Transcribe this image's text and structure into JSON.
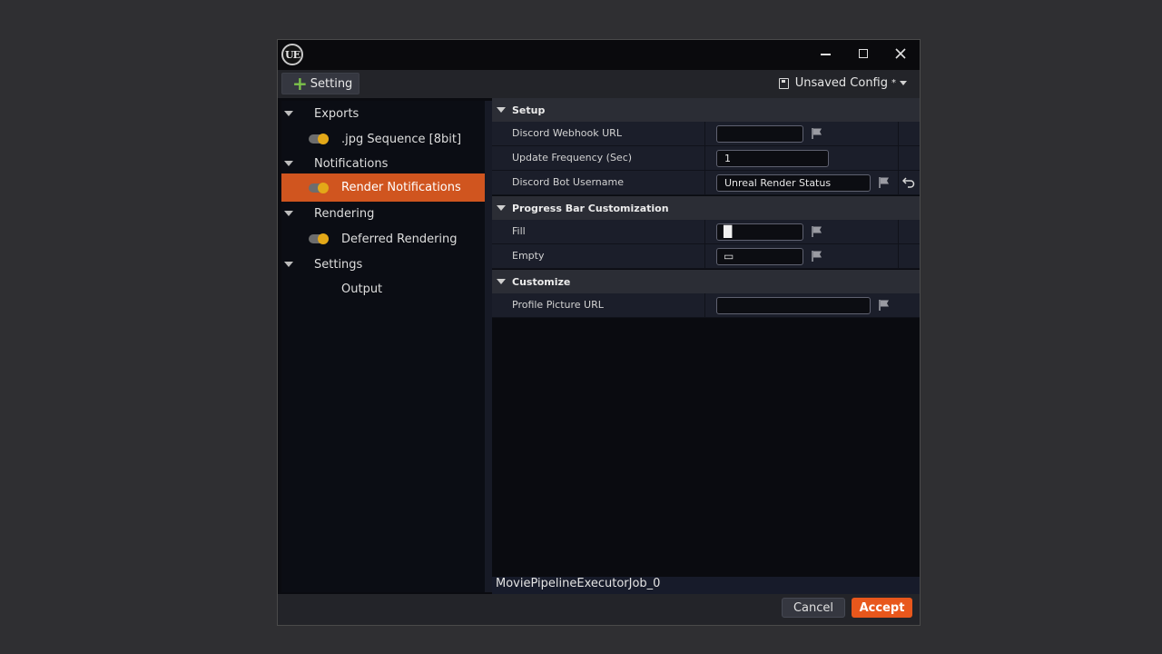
{
  "window": {
    "logo_text": "UE"
  },
  "toolbar": {
    "add_label": "Setting",
    "config_label": "Unsaved Config",
    "config_modified": "*"
  },
  "tree": [
    {
      "type": "category",
      "label": "Exports"
    },
    {
      "type": "child",
      "label": ".jpg Sequence [8bit]",
      "toggle": true
    },
    {
      "type": "category",
      "label": "Notifications"
    },
    {
      "type": "child",
      "label": "Render Notifications",
      "toggle": true,
      "selected": true
    },
    {
      "type": "category",
      "label": "Rendering"
    },
    {
      "type": "child",
      "label": "Deferred Rendering",
      "toggle": true
    },
    {
      "type": "category",
      "label": "Settings"
    },
    {
      "type": "child",
      "label": "Output",
      "toggle": false
    }
  ],
  "details": {
    "setup": {
      "header": "Setup",
      "webhook_label": "Discord Webhook URL",
      "webhook_value": "",
      "frequency_label": "Update Frequency (Sec)",
      "frequency_value": "1",
      "username_label": "Discord Bot Username",
      "username_value": "Unreal Render Status"
    },
    "progress": {
      "header": "Progress Bar Customization",
      "fill_label": "Fill",
      "fill_value": "█",
      "empty_label": "Empty",
      "empty_value": "▭"
    },
    "customize": {
      "header": "Customize",
      "profile_label": "Profile Picture URL",
      "profile_value": ""
    }
  },
  "job_name": "MoviePipelineExecutorJob_0",
  "footer": {
    "cancel_label": "Cancel",
    "accept_label": "Accept"
  },
  "colors": {
    "accent": "#e8571c",
    "selection": "#d0551f",
    "toggle_on": "#e3a818",
    "add_icon": "#7cc24a"
  }
}
